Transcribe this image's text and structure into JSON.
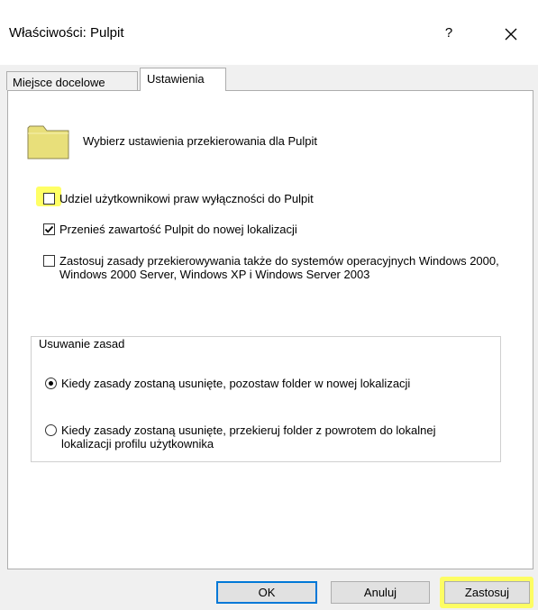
{
  "window": {
    "title": "Właściwości: Pulpit",
    "help_label": "?",
    "close_label": "×"
  },
  "tabs": [
    {
      "label": "Miejsce docelowe",
      "selected": false
    },
    {
      "label": "Ustawienia",
      "selected": true
    }
  ],
  "settings": {
    "header": "Wybierz ustawienia przekierowania dla Pulpit",
    "options": [
      {
        "label": "Udziel użytkownikowi praw wyłączności do Pulpit",
        "checked": false,
        "highlighted": true
      },
      {
        "label": "Przenieś zawartość Pulpit do nowej lokalizacji",
        "checked": true,
        "highlighted": false
      },
      {
        "label": "Zastosuj zasady przekierowywania także do systemów operacyjnych Windows 2000, Windows 2000 Server, Windows XP i Windows Server 2003",
        "checked": false,
        "highlighted": false
      }
    ]
  },
  "policy_removal": {
    "legend": "Usuwanie zasad",
    "options": [
      {
        "label": "Kiedy zasady zostaną usunięte, pozostaw folder w nowej lokalizacji",
        "selected": true
      },
      {
        "label": "Kiedy zasady zostaną usunięte, przekieruj folder z powrotem do lokalnej lokalizacji profilu użytkownika",
        "selected": false
      }
    ]
  },
  "buttons": {
    "ok": "OK",
    "cancel": "Anuluj",
    "apply": "Zastosuj"
  },
  "colors": {
    "highlight": "#ffff4a",
    "dialog_bg": "#f0f0f0",
    "default_button_border": "#0078d7",
    "folder_fill": "#e8df7a"
  }
}
